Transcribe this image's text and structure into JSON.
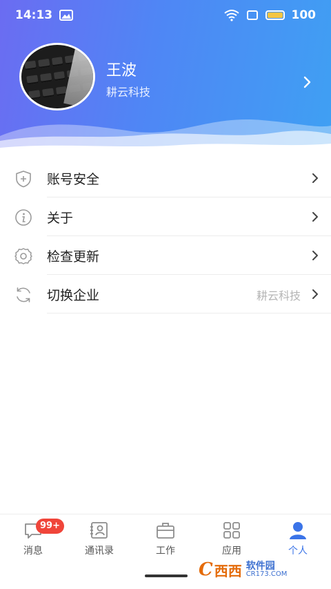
{
  "status_bar": {
    "time": "14:13",
    "battery": "100",
    "icons": [
      "image-icon",
      "wifi-icon",
      "sim-icon",
      "battery-icon"
    ]
  },
  "profile": {
    "name": "王波",
    "company": "耕云科技",
    "arrow_icon": "chevron-right-icon"
  },
  "menu": {
    "items": [
      {
        "label": "账号安全",
        "icon": "shield-plus-icon",
        "value": ""
      },
      {
        "label": "关于",
        "icon": "info-icon",
        "value": ""
      },
      {
        "label": "检查更新",
        "icon": "gear-icon",
        "value": ""
      },
      {
        "label": "切换企业",
        "icon": "refresh-icon",
        "value": "耕云科技"
      }
    ]
  },
  "tabbar": {
    "tabs": [
      {
        "label": "消息",
        "icon": "message-icon",
        "badge": "99+"
      },
      {
        "label": "通讯录",
        "icon": "contacts-icon"
      },
      {
        "label": "工作",
        "icon": "briefcase-icon"
      },
      {
        "label": "应用",
        "icon": "apps-grid-icon"
      },
      {
        "label": "个人",
        "icon": "user-icon",
        "active": true
      }
    ]
  },
  "watermark": {
    "logo": "C",
    "brand": "西西",
    "title": "软件园",
    "domain": "CR173.COM"
  },
  "colors": {
    "accent": "#3b74e8",
    "badge": "#f0453a",
    "header_start": "#6b6cf2",
    "header_end": "#3fa0f3"
  }
}
